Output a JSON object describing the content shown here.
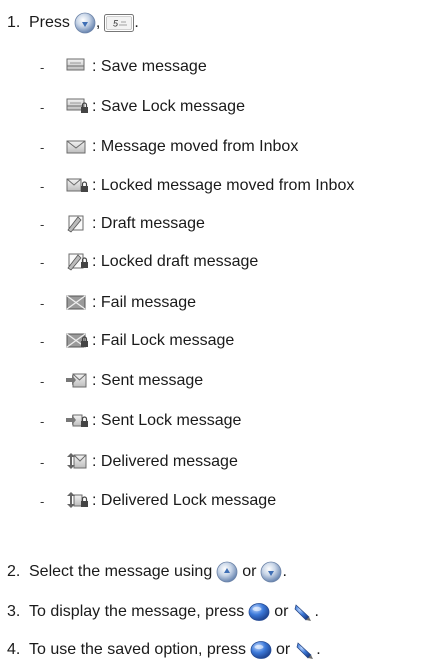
{
  "steps": [
    {
      "num": "1.",
      "text": "Press",
      "sep": ",",
      "end": "."
    },
    {
      "num": "2.",
      "text": "Select the message using",
      "or": "or",
      "end": "."
    },
    {
      "num": "3.",
      "text": "To display the message, press",
      "or": "or",
      "end": "."
    },
    {
      "num": "4.",
      "text": "To use the saved option, press",
      "or": "or",
      "end": "."
    }
  ],
  "key_5_label": "5",
  "dash": "-",
  "icon_items": [
    {
      "icon": "save-message-icon",
      "text": ": Save message"
    },
    {
      "icon": "save-lock-message-icon",
      "text": ": Save Lock message"
    },
    {
      "icon": "message-moved-from-inbox-icon",
      "text": ": Message moved from Inbox"
    },
    {
      "icon": "locked-message-moved-from-inbox-icon",
      "text": ": Locked message moved from Inbox"
    },
    {
      "icon": "draft-message-icon",
      "text": ": Draft message"
    },
    {
      "icon": "locked-draft-message-icon",
      "text": ": Locked draft message"
    },
    {
      "icon": "fail-message-icon",
      "text": ": Fail message"
    },
    {
      "icon": "fail-lock-message-icon",
      "text": ": Fail Lock message"
    },
    {
      "icon": "sent-message-icon",
      "text": ": Sent message"
    },
    {
      "icon": "sent-lock-message-icon",
      "text": ": Sent Lock message"
    },
    {
      "icon": "delivered-message-icon",
      "text": ": Delivered message"
    },
    {
      "icon": "delivered-lock-message-icon",
      "text": ": Delivered Lock message"
    }
  ],
  "colors": {
    "text": "#1a1a1a",
    "nav_key": "#3f6fb5",
    "soft_key": "#2d63c4",
    "icon_stroke": "#6b6b6b"
  }
}
